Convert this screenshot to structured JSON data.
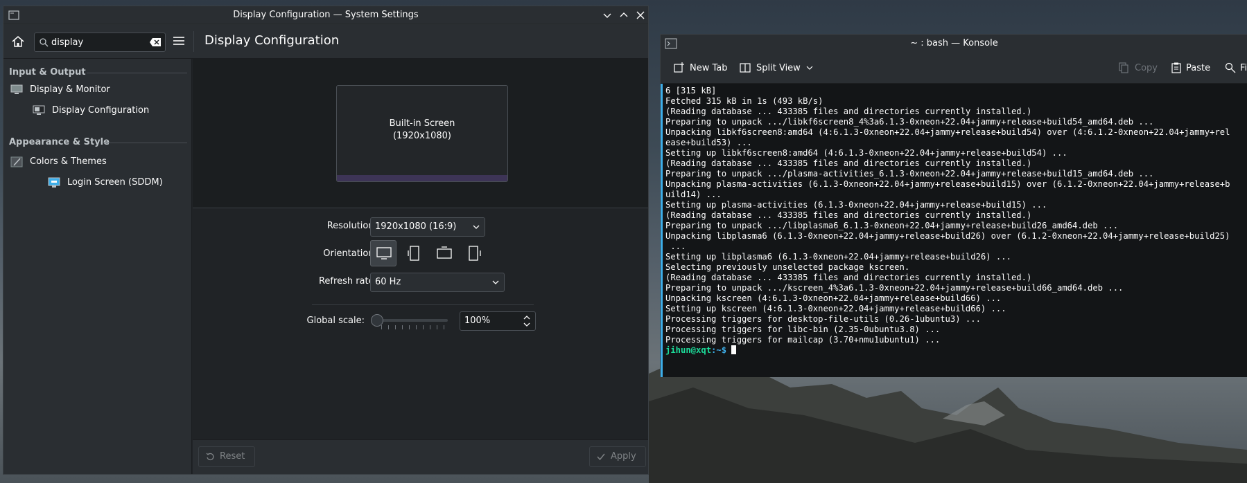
{
  "settings": {
    "window_title": "Display Configuration — System Settings",
    "search_value": "display",
    "page_title": "Display Configuration",
    "sidebar": {
      "categories": [
        "Input & Output",
        "Appearance & Style"
      ],
      "items": [
        {
          "label": "Display & Monitor",
          "icon": "monitor-icon"
        },
        {
          "label": "Display Configuration",
          "icon": "display-config-icon"
        },
        {
          "label": "Colors & Themes",
          "icon": "colors-icon"
        },
        {
          "label": "Login Screen (SDDM)",
          "icon": "login-screen-icon"
        }
      ]
    },
    "screen": {
      "name": "Built-in Screen",
      "resolution": "(1920x1080)"
    },
    "form": {
      "resolution_label": "Resolution:",
      "resolution_value": "1920x1080 (16:9)",
      "orientation_label": "Orientation:",
      "refresh_label": "Refresh rate:",
      "refresh_value": "60 Hz",
      "scale_label": "Global scale:",
      "scale_value": "100%"
    },
    "footer": {
      "reset_label": "Reset",
      "apply_label": "Apply"
    }
  },
  "konsole": {
    "window_title": "~ : bash — Konsole",
    "toolbar": {
      "new_tab": "New Tab",
      "split_view": "Split View",
      "copy": "Copy",
      "paste": "Paste",
      "find": "Fi"
    },
    "lines": [
      "6 [315 kB]",
      "Fetched 315 kB in 1s (493 kB/s)",
      "(Reading database ... 433385 files and directories currently installed.)",
      "Preparing to unpack .../libkf6screen8_4%3a6.1.3-0xneon+22.04+jammy+release+build54_amd64.deb ...",
      "Unpacking libkf6screen8:amd64 (4:6.1.3-0xneon+22.04+jammy+release+build54) over (4:6.1.2-0xneon+22.04+jammy+rel",
      "ease+build53) ...",
      "Setting up libkf6screen8:amd64 (4:6.1.3-0xneon+22.04+jammy+release+build54) ...",
      "(Reading database ... 433385 files and directories currently installed.)",
      "Preparing to unpack .../plasma-activities_6.1.3-0xneon+22.04+jammy+release+build15_amd64.deb ...",
      "Unpacking plasma-activities (6.1.3-0xneon+22.04+jammy+release+build15) over (6.1.2-0xneon+22.04+jammy+release+b",
      "uild14) ...",
      "Setting up plasma-activities (6.1.3-0xneon+22.04+jammy+release+build15) ...",
      "(Reading database ... 433385 files and directories currently installed.)",
      "Preparing to unpack .../libplasma6_6.1.3-0xneon+22.04+jammy+release+build26_amd64.deb ...",
      "Unpacking libplasma6 (6.1.3-0xneon+22.04+jammy+release+build26) over (6.1.2-0xneon+22.04+jammy+release+build25)",
      " ...",
      "Setting up libplasma6 (6.1.3-0xneon+22.04+jammy+release+build26) ...",
      "Selecting previously unselected package kscreen.",
      "(Reading database ... 433385 files and directories currently installed.)",
      "Preparing to unpack .../kscreen_4%3a6.1.3-0xneon+22.04+jammy+release+build66_amd64.deb ...",
      "Unpacking kscreen (4:6.1.3-0xneon+22.04+jammy+release+build66) ...",
      "Setting up kscreen (4:6.1.3-0xneon+22.04+jammy+release+build66) ...",
      "Processing triggers for desktop-file-utils (0.26-1ubuntu3) ...",
      "Processing triggers for libc-bin (2.35-0ubuntu3.8) ...",
      "Processing triggers for mailcap (3.70+nmu1ubuntu1) ..."
    ],
    "prompt_user": "jihun@xqt",
    "prompt_path": ":~$ "
  },
  "colors": {
    "accent": "#3daee9",
    "prompt_green": "#1cdc9a"
  }
}
